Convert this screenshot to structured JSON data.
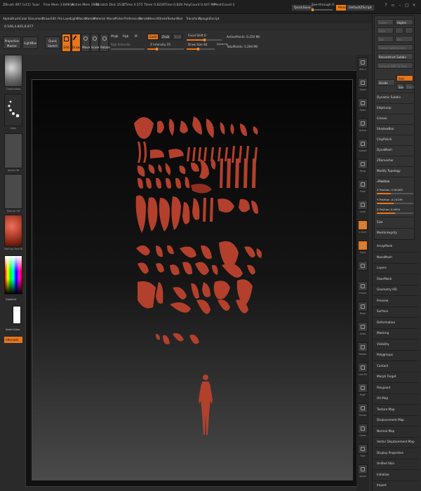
{
  "titlebar": {
    "app": "ZBrush 4R7 [v11]",
    "doc": "Suar",
    "stats": [
      "Free Mem 3.849GB",
      "Active Mem 2986",
      "Scratch Disk 3531",
      "ZTime 4.575",
      "Timer 0.822",
      "ATime 0.828",
      "PolyCount 0.447 MP",
      "MeshCount 2"
    ],
    "quicksave": "QuickSave",
    "seethrough_label": "See-through 0",
    "seethrough_value": 0,
    "menus_btn": "Menus",
    "script_btn": "DefaultZScript"
  },
  "menubar": [
    "Alpha",
    "Brush",
    "Color",
    "Document",
    "Draw",
    "Edit",
    "File",
    "Layer",
    "Light",
    "Macro",
    "Marker",
    "Material",
    "Movie",
    "Picker",
    "Preferences",
    "Render",
    "Stencil",
    "Stroke",
    "Texture",
    "Tool",
    "Transform",
    "Zplugin",
    "Zscript"
  ],
  "coords": "0.548,4.845,8.877",
  "toolbar": {
    "projection_master": "Projection Master",
    "lightbox": "LightBox",
    "quick_sketch": "Quick Sketch",
    "edit": "Edit",
    "draw": "Draw",
    "move": "Move",
    "scale": "Scale",
    "rotate": "Rotate",
    "mrgb": "Mrgb",
    "rgb": "Rgb",
    "m": "M",
    "rgb_intensity": "Rgb Intensity",
    "zadd": "Zadd",
    "zsub": "Zsub",
    "zcut": "Zcut",
    "z_intensity_label": "Z Intensity 25",
    "z_intensity": 25,
    "focal_shift_label": "Focal Shift 0",
    "focal_shift": 0,
    "draw_size_label": "Draw Size 64",
    "draw_size": 64,
    "dynamic": "Dynamic",
    "active_points": "ActivePoints: 0.220 Mil",
    "total_points": "TotalPoints: 5.294 Mil"
  },
  "leftshelf": {
    "brush_label": "ClayBuildup",
    "stroke_label": "Dots",
    "alpha_label": "Alpha Off",
    "texture_label": "Texture Off",
    "material_label": "MatCap Red Wax",
    "gradient": "Gradient",
    "switch_color": "SwitchColor",
    "alternate": "Alternate"
  },
  "rightshelf": {
    "labels": [
      "SPix 3",
      "Scroll",
      "Zoom",
      "Actual",
      "AAHalf",
      "Persp",
      "Floor",
      "Local",
      "L.Sym",
      "Gxyz",
      "",
      "Frame",
      "Move",
      "Scale",
      "Rotate",
      "Line Fill",
      "PolyF",
      "Transp",
      "Ghost",
      "Solo",
      "Xpose"
    ]
  },
  "subpanel": {
    "lower_res": "Lower Res",
    "higher_res": "Higher Res",
    "sdiv": "SDiv",
    "del_lower": "Del Lower",
    "del_higher": "Del Higher",
    "freeze_subdiv": "Freeze SubDivision Levels",
    "reconstruct": "Reconstruct Subdiv",
    "convert_bpr": "Convert BPR To Geo",
    "divide": "Divide",
    "smt": "Smt",
    "suv": "Suv",
    "rsmt": "ReUV",
    "items": [
      "Dynamic Subdiv",
      "EdgeLoop",
      "Crease",
      "ShadowBox",
      "ClayPolish",
      "DynaMesh",
      "ZRemesher",
      "Modify Topology"
    ],
    "position_header": "Position",
    "x_position_label": "X Position -0.64469",
    "x_position": -0.64469,
    "y_position_label": "Y Position -0.24239",
    "y_position": -0.24239,
    "z_position_label": "Z Position 0.0004",
    "z_position": 0.0004,
    "size": "Size",
    "mesh_integrity": "MeshIntegrity"
  },
  "palette_items": [
    "ArrayMesh",
    "NanoMesh",
    "Layers",
    "FiberMesh",
    "Geometry HD",
    "Preview",
    "Surface",
    "Deformation",
    "Masking",
    "Visibility",
    "Polygroups",
    "Contact",
    "Morph Target",
    "Polypaint",
    "UV Map",
    "Texture Map",
    "Displacement Map",
    "Normal Map",
    "Vector Displacement Map",
    "Display Properties",
    "Unified Skin",
    "Initialize",
    "Import"
  ],
  "colors": {
    "accent": "#e8761a",
    "clay": "#b3402c",
    "panel": "#2c2c2c"
  }
}
